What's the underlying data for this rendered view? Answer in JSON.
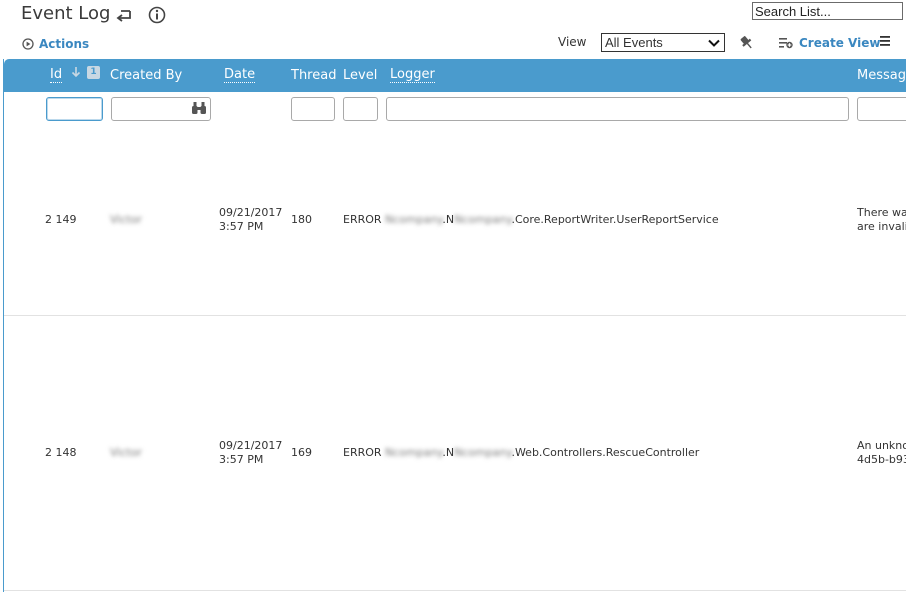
{
  "header": {
    "title": "Event Log",
    "search_placeholder": "Search List...",
    "actions_label": "Actions",
    "view_label": "View",
    "view_selected": "All Events",
    "create_view_label": "Create View"
  },
  "grid": {
    "columns": {
      "id": "Id",
      "created_by": "Created By",
      "date": "Date",
      "thread": "Thread",
      "level": "Level",
      "logger": "Logger",
      "message": "Message"
    },
    "sort_badge": "1",
    "rows": [
      {
        "id": "2 149",
        "created_by": "Victor",
        "date_line1": "09/21/2017",
        "date_line2": "3:57 PM",
        "thread": "180",
        "level": "ERROR",
        "logger_redacted_1": "Ncompany",
        "logger_mid": ".N",
        "logger_redacted_2": "Ncompany",
        "logger_tail": ".Core.ReportWriter.UserReportService",
        "message_line1": "There wa",
        "message_line2": "are invali"
      },
      {
        "id": "2 148",
        "created_by": "Victor",
        "date_line1": "09/21/2017",
        "date_line2": "3:57 PM",
        "thread": "169",
        "level": "ERROR",
        "logger_redacted_1": "Ncompany",
        "logger_mid": ".N",
        "logger_redacted_2": "Ncompany",
        "logger_tail": ".Web.Controllers.RescueController",
        "message_line1": "An unkno",
        "message_line2": "4d5b-b93"
      }
    ]
  },
  "colors": {
    "accent": "#4a9bcd",
    "link": "#3a87c0"
  },
  "icons": [
    "undo-icon",
    "info-icon",
    "play-circle-icon",
    "chevron-down-icon",
    "pin-icon",
    "create-view-icon",
    "menu-icon",
    "sort-down-arrow-icon",
    "binoculars-icon"
  ]
}
